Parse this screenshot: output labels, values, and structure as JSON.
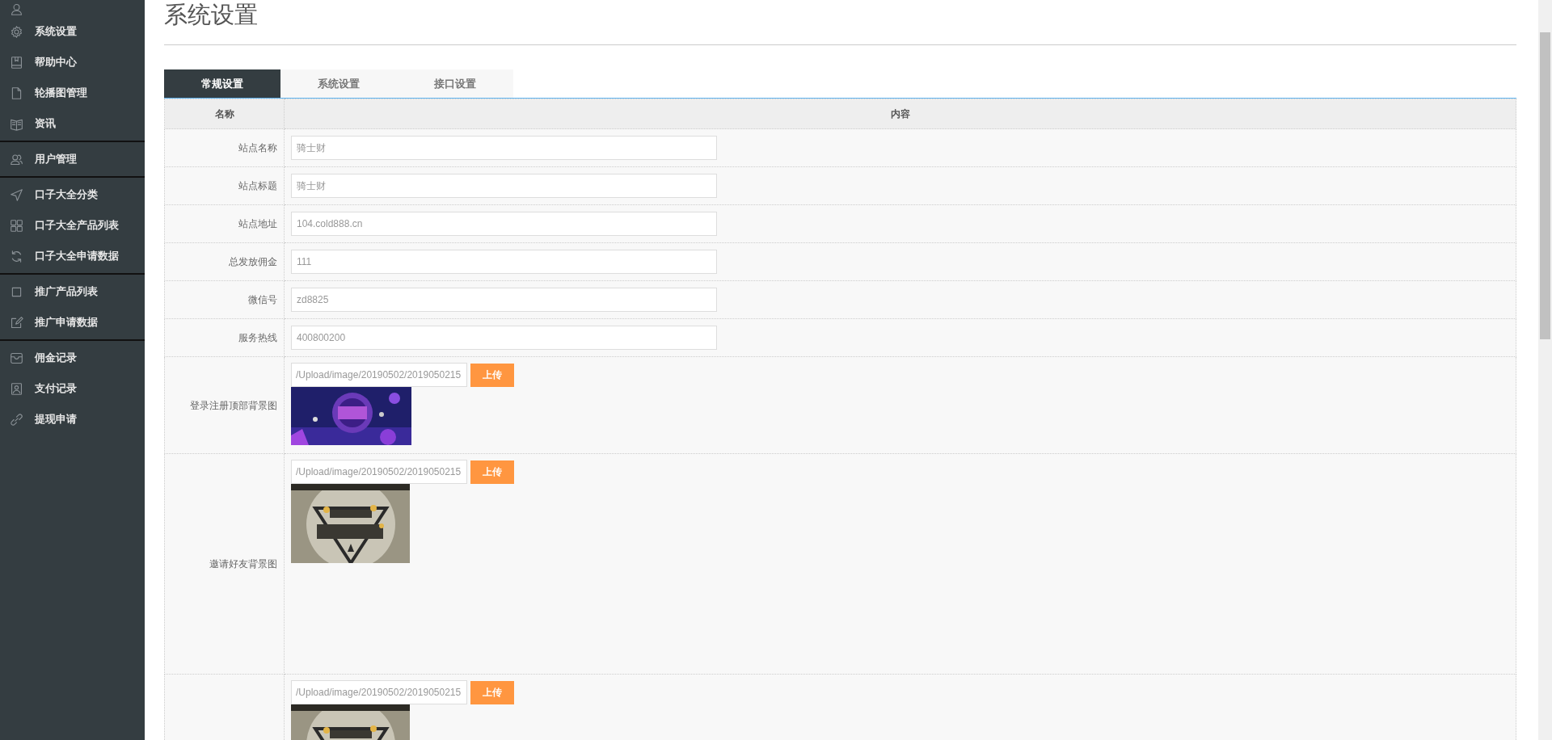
{
  "sidebar": {
    "groups": [
      {
        "items": [
          {
            "kind": "cut"
          },
          {
            "label": "系统设置"
          },
          {
            "label": "帮助中心"
          },
          {
            "label": "轮播图管理"
          },
          {
            "label": "资讯"
          }
        ]
      },
      {
        "items": [
          {
            "label": "用户管理"
          }
        ]
      },
      {
        "items": [
          {
            "label": "口子大全分类"
          },
          {
            "label": "口子大全产品列表"
          },
          {
            "label": "口子大全申请数据"
          }
        ]
      },
      {
        "items": [
          {
            "label": "推广产品列表"
          },
          {
            "label": "推广申请数据"
          }
        ]
      },
      {
        "items": [
          {
            "label": "佣金记录"
          },
          {
            "label": "支付记录"
          },
          {
            "label": "提现申请"
          }
        ]
      }
    ]
  },
  "page_title": "系统设置",
  "tabs": [
    {
      "label": "常规设置",
      "selected": true
    },
    {
      "label": "系统设置",
      "selected": false
    },
    {
      "label": "接口设置",
      "selected": false
    }
  ],
  "table": {
    "columns": [
      "名称",
      "内容"
    ],
    "rows": [
      {
        "kind": "text",
        "label": "站点名称",
        "value": "骑士财"
      },
      {
        "kind": "text",
        "label": "站点标题",
        "value": "骑士财"
      },
      {
        "kind": "text",
        "label": "站点地址",
        "value": "104.cold888.cn"
      },
      {
        "kind": "text",
        "label": "总发放佣金",
        "value": "111"
      },
      {
        "kind": "text",
        "label": "微信号",
        "value": "zd8825"
      },
      {
        "kind": "text",
        "label": "服务热线",
        "value": "400800200"
      },
      {
        "label": "登录注册顶部背景图",
        "value": "/Upload/image/20190502/2019050215",
        "button": "上传"
      },
      {
        "label": "邀请好友背景图",
        "value": "/Upload/image/20190502/2019050215",
        "button": "上传"
      },
      {
        "value": "/Upload/image/20190502/2019050215",
        "button": "上传"
      }
    ]
  }
}
